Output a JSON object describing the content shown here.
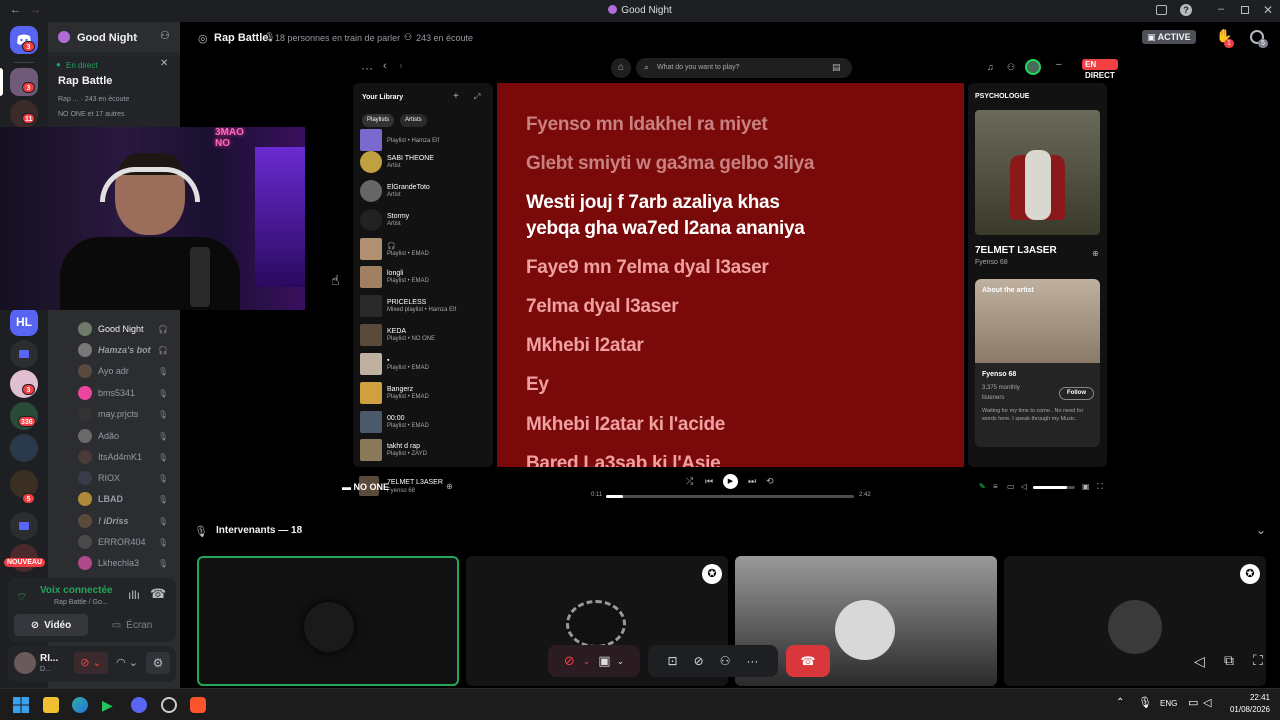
{
  "window": {
    "title": "Good Night"
  },
  "header": {
    "server_name": "Good Night",
    "stage_name": "Rap Battle",
    "speakers_text": "18 personnes en train de parler",
    "listeners_text": "243 en écoute",
    "active_label": "ACTIVE",
    "live_label": "EN DIRECT",
    "hand_count": "1",
    "inbox_count": "5"
  },
  "live_card": {
    "badge": "En direct",
    "title": "Rap Battle",
    "host": "Rap ...",
    "listeners": "243 en écoute",
    "others": "NO ONE et 17 autres"
  },
  "rail_badges": [
    "3",
    "3",
    "11",
    "3",
    "336",
    "5"
  ],
  "rail_new": "NOUVEAU",
  "members": [
    {
      "name": "Good Night",
      "color": "#dbdee1",
      "icon": "🎧"
    },
    {
      "name": "Hamza's bot",
      "color": "#949ba4",
      "icon": "🎧"
    },
    {
      "name": "Ayo adr",
      "color": "#949ba4",
      "icon": "🎙"
    },
    {
      "name": "bms5341",
      "color": "#949ba4",
      "icon": "🎙"
    },
    {
      "name": "may.prjcts",
      "color": "#949ba4",
      "icon": "🎙"
    },
    {
      "name": "Adão",
      "color": "#949ba4",
      "icon": "🎙"
    },
    {
      "name": "ItsAd4mK1",
      "color": "#949ba4",
      "icon": "🎙"
    },
    {
      "name": "RIOX",
      "color": "#949ba4",
      "icon": "🎙"
    },
    {
      "name": "LBAD",
      "color": "#949ba4",
      "icon": "🎙"
    },
    {
      "name": "! iDriss",
      "color": "#949ba4",
      "icon": "🎙"
    },
    {
      "name": "ERROR404",
      "color": "#949ba4",
      "icon": "🎙"
    },
    {
      "name": "Lkhechla3",
      "color": "#949ba4",
      "icon": "🎙"
    }
  ],
  "voice": {
    "connected": "Voix connectée",
    "channel": "Rap Battle / Go...",
    "video_label": "Vidéo",
    "screen_label": "Écran"
  },
  "user": {
    "name": "RI...",
    "status": "D..."
  },
  "spotify": {
    "search_placeholder": "What do you want to play?",
    "library_title": "Your Library",
    "filter_playlists": "Playlists",
    "filter_artists": "Artists",
    "live_label": "EN DIRECT",
    "library": [
      {
        "title": "",
        "sub": "Playlist • Hamza Elf"
      },
      {
        "title": "SABI THEONE",
        "sub": "Artist"
      },
      {
        "title": "ElGrandeToto",
        "sub": "Artist"
      },
      {
        "title": "Stormy",
        "sub": "Artist"
      },
      {
        "title": "🎧",
        "sub": "Playlist • EMAD"
      },
      {
        "title": "longli",
        "sub": "Playlist • EMAD"
      },
      {
        "title": "PRICELESS",
        "sub": "Mixed playlist • Hamza Elf"
      },
      {
        "title": "KEDA",
        "sub": "Playlist • NO ONE"
      },
      {
        "title": "▪",
        "sub": "Playlist • EMAD"
      },
      {
        "title": "Bangerz",
        "sub": "Playlist • EMAD"
      },
      {
        "title": "00:00",
        "sub": "Playlist • EMAD"
      },
      {
        "title": "takht d rap",
        "sub": "Playlist • ZAYD"
      }
    ],
    "lyrics": [
      {
        "text": "Fyenso mn ldakhel ra miyet",
        "state": "past"
      },
      {
        "text": "Glebt smiyti w ga3ma gelbo 3liya",
        "state": "past"
      },
      {
        "text": "Westi jouj f 7arb azaliya khas",
        "state": "current"
      },
      {
        "text": "yebqa gha wa7ed l2ana ananiya",
        "state": "current"
      },
      {
        "text": "Faye9 mn 7elma dyal l3aser",
        "state": "next"
      },
      {
        "text": "7elma dyal l3aser",
        "state": "next"
      },
      {
        "text": "Mkhebi l2atar",
        "state": "next"
      },
      {
        "text": "Ey",
        "state": "next"
      },
      {
        "text": "Mkhebi l2atar ki l'acide",
        "state": "next"
      },
      {
        "text": "Bared La3sab ki l'Asie",
        "state": "next"
      }
    ],
    "right_panel_title": "PSYCHOLOGUE",
    "track_title": "7ELMET L3ASER",
    "track_artist": "Fyenso 68",
    "about_label": "About the artist",
    "artist_name": "Fyenso 68",
    "monthly": "3,375 monthly listeners",
    "follow_label": "Follow",
    "bio": "Waiting for my time to come.. No need for words here. I speak through my Music.",
    "now_playing": "7ELMET L3ASER",
    "now_artist": "Fyenso 68",
    "elapsed": "0:11",
    "duration": "2:42",
    "progress_fraction": 0.07,
    "volume_fraction": 0.8
  },
  "overlay_name": "NO ONE",
  "speakers": {
    "label": "Intervenants — 18"
  },
  "clock": {
    "time": "22:41",
    "date": "01/08/2026",
    "lang": "ENG"
  }
}
